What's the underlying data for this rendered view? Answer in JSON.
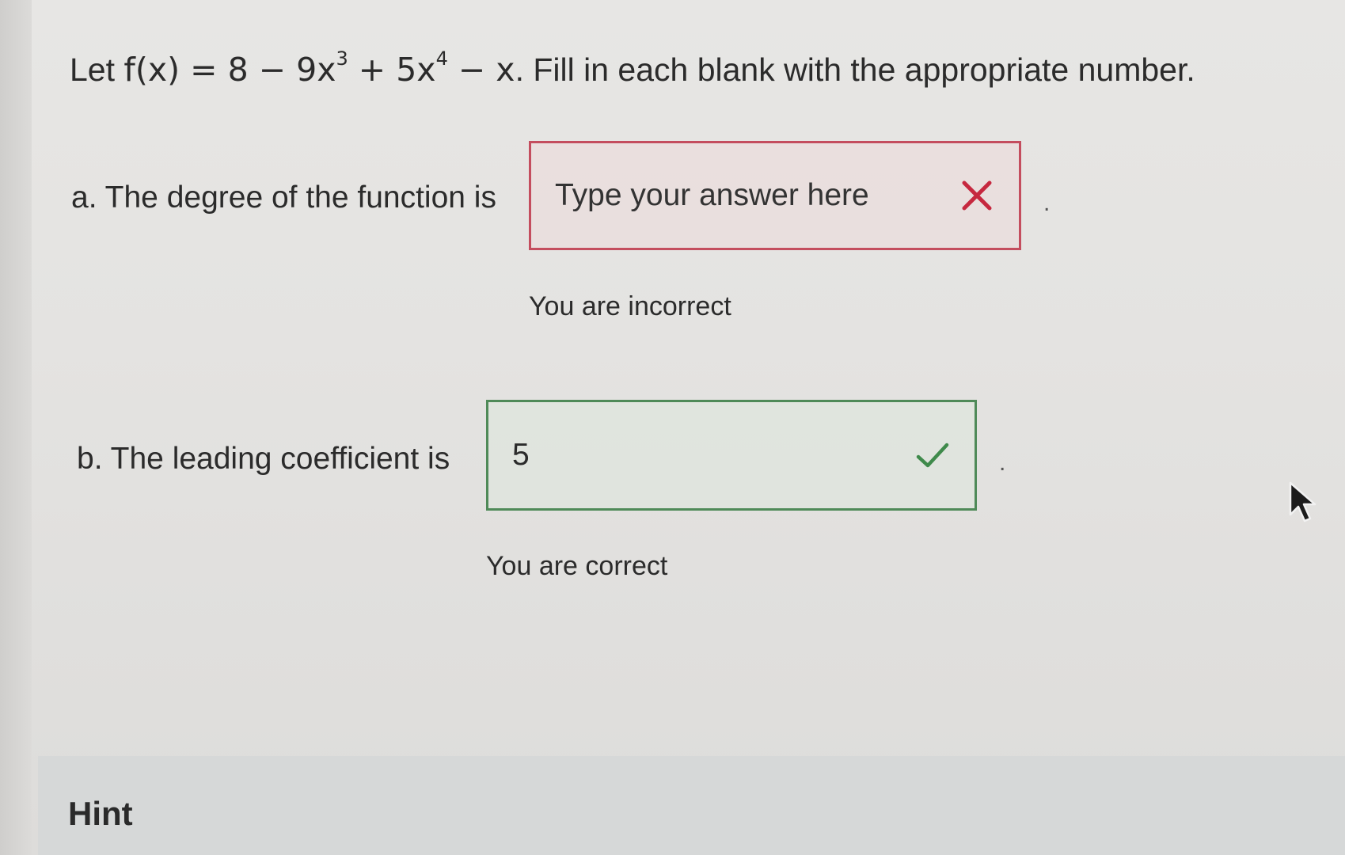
{
  "question": {
    "prefix": "Let",
    "function_name": "f(x)",
    "equals": "=",
    "term_1": "8",
    "op_1": "−",
    "term_2_coef": "9x",
    "term_2_exp": "3",
    "op_2": "+",
    "term_3_coef": "5x",
    "term_3_exp": "4",
    "op_3": "−",
    "term_4": "x",
    "instruction": ". Fill in each blank with the appropriate number."
  },
  "part_a": {
    "label": "a. The degree of the function is",
    "input_value": "",
    "input_placeholder": "Type your answer here",
    "status_icon": "x-icon",
    "status_color": "#c6283f",
    "feedback": "You are incorrect",
    "period": "."
  },
  "part_b": {
    "label": "b. The leading coefficient is",
    "input_value": "5",
    "input_placeholder": "",
    "status_icon": "check-icon",
    "status_color": "#3f8a4b",
    "feedback": "You are correct",
    "period": "."
  },
  "hint": {
    "label": "Hint"
  }
}
